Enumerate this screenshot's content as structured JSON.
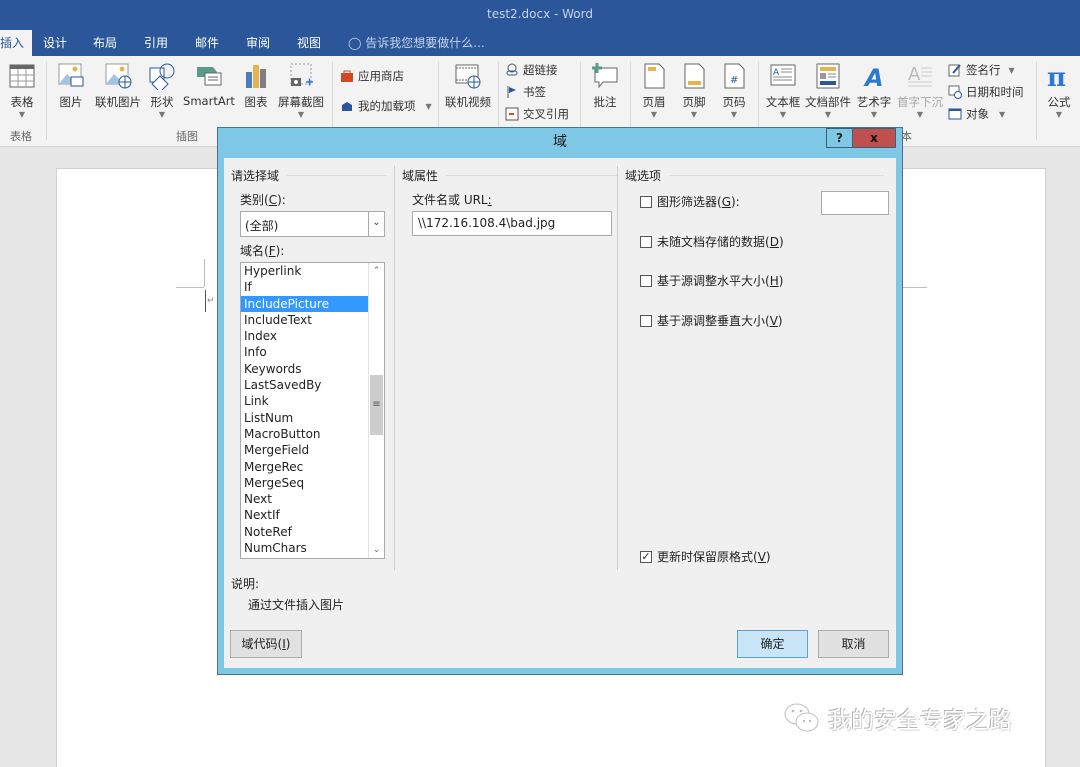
{
  "window": {
    "title": "test2.docx - Word"
  },
  "tabs": [
    {
      "label": "插入",
      "active": true
    },
    {
      "label": "设计"
    },
    {
      "label": "布局"
    },
    {
      "label": "引用"
    },
    {
      "label": "邮件"
    },
    {
      "label": "审阅"
    },
    {
      "label": "视图"
    }
  ],
  "tell_me": {
    "placeholder": "告诉我您想要做什么..."
  },
  "ribbon": {
    "groups": {
      "tables": "表格",
      "illustrations": "插图",
      "text_partial": "本"
    },
    "buttons": {
      "table": "表格",
      "pictures": "图片",
      "online_pictures": "联机图片",
      "shapes": "形状",
      "smartart": "SmartArt",
      "chart": "图表",
      "screenshot": "屏幕截图",
      "store": "应用商店",
      "my_addins": "我的加载项",
      "online_video": "联机视频",
      "hyperlink": "超链接",
      "bookmark": "书签",
      "cross_reference": "交叉引用",
      "comment": "批注",
      "header": "页眉",
      "footer": "页脚",
      "page_number": "页码",
      "text_box": "文本框",
      "quick_parts": "文档部件",
      "wordart": "艺术字",
      "drop_cap": "首字下沉",
      "signature_line": "签名行",
      "date_time": "日期和时间",
      "object": "对象",
      "equation": "公式"
    }
  },
  "dialog": {
    "title": "域",
    "help_label": "?",
    "close_label": "x",
    "choose_field": {
      "group_title": "请选择域",
      "category_label": "类别(",
      "category_key": "C",
      "category_tail": "):",
      "category_value": "(全部)",
      "field_names_label": "域名(",
      "field_names_key": "F",
      "field_names_tail": "):",
      "field_names": [
        "Hyperlink",
        "If",
        "IncludePicture",
        "IncludeText",
        "Index",
        "Info",
        "Keywords",
        "LastSavedBy",
        "Link",
        "ListNum",
        "MacroButton",
        "MergeField",
        "MergeRec",
        "MergeSeq",
        "Next",
        "NextIf",
        "NoteRef",
        "NumChars"
      ],
      "selected_field": "IncludePicture"
    },
    "field_properties": {
      "group_title": "域属性",
      "filename_label": "文件名或 URL",
      "filename_label_tail": ":",
      "filename_value": "\\\\172.16.108.4\\bad.jpg"
    },
    "field_options": {
      "group_title": "域选项",
      "options": [
        {
          "label": "图形筛选器(",
          "key": "G",
          "tail": "):",
          "checked": false
        },
        {
          "label": "未随文档存储的数据(",
          "key": "D",
          "tail": ")",
          "checked": false
        },
        {
          "label": "基于源调整水平大小(",
          "key": "H",
          "tail": ")",
          "checked": false
        },
        {
          "label": "基于源调整垂直大小(",
          "key": "V",
          "tail": ")",
          "checked": false
        }
      ],
      "preserve_formatting": {
        "label": "更新时保留原格式(",
        "key": "V",
        "tail": ")",
        "checked": true
      }
    },
    "description": {
      "label": "说明:",
      "text": "通过文件插入图片"
    },
    "field_codes_button": {
      "label": "域代码(",
      "key": "I",
      "tail": ")"
    },
    "ok_button": "确定",
    "cancel_button": "取消"
  },
  "watermark": {
    "text": "我的安全专家之路"
  }
}
